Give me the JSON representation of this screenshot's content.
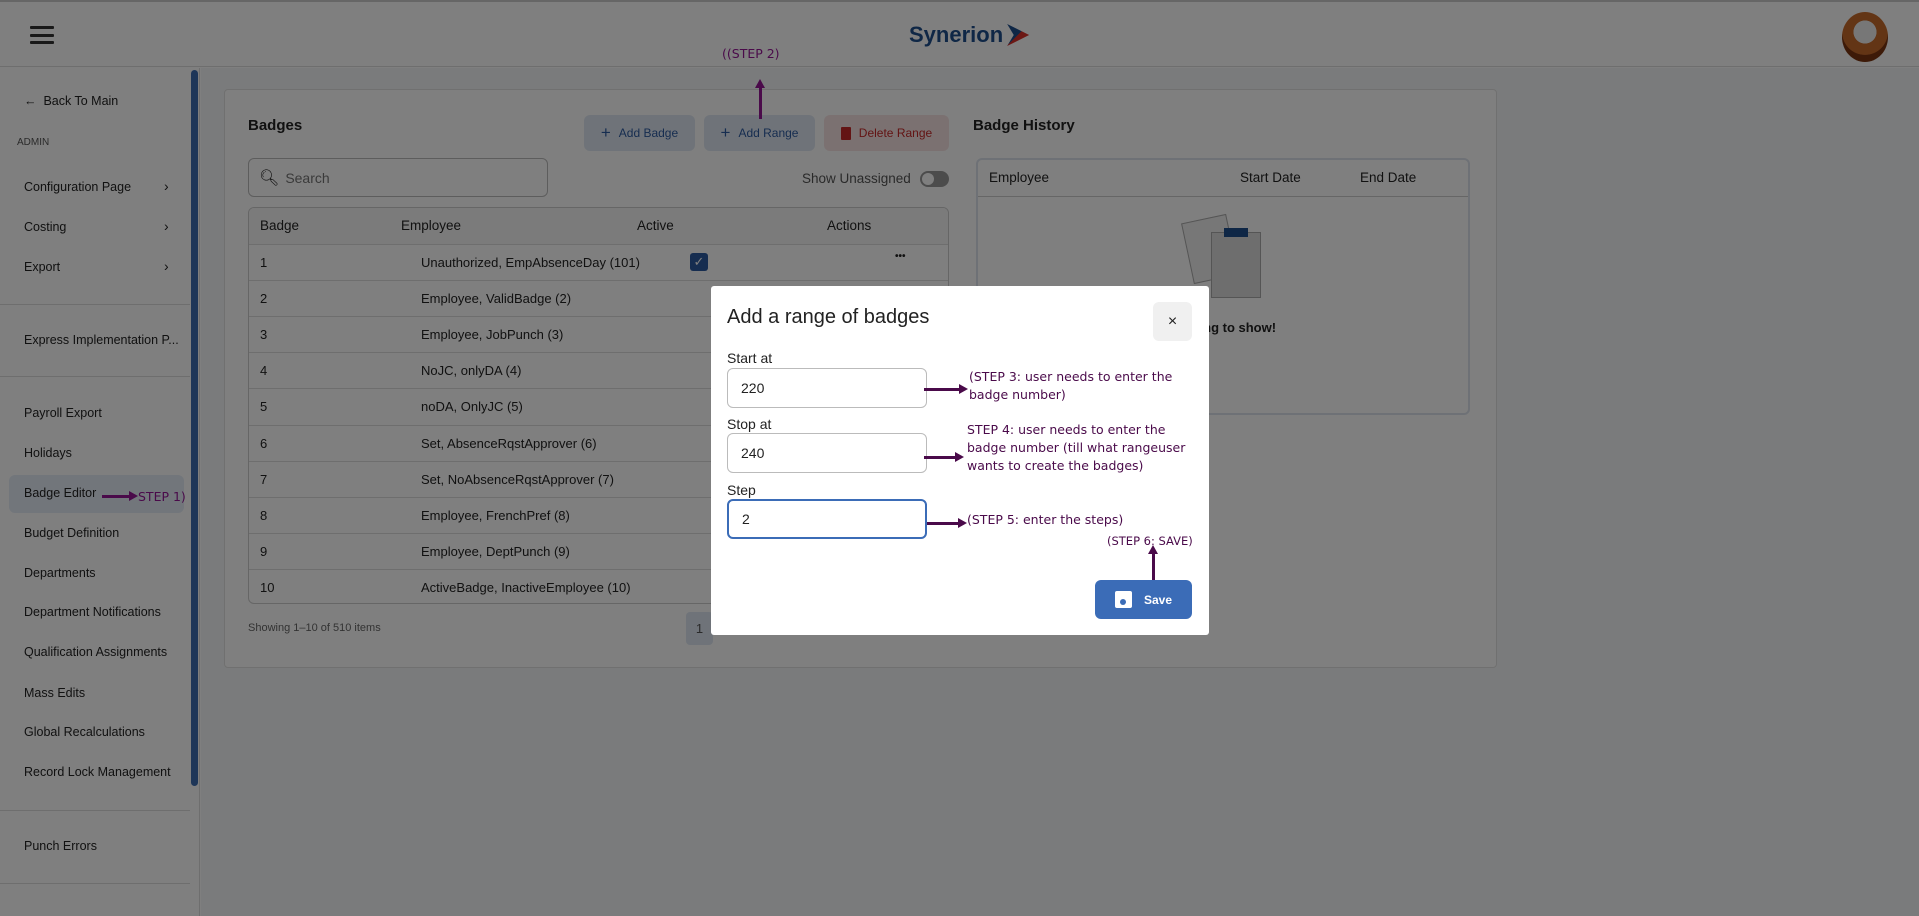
{
  "header": {
    "brand": "Synerion",
    "menu_icon": "hamburger-icon",
    "avatar": "user-avatar"
  },
  "sidebar": {
    "back": "Back To Main",
    "section": "ADMIN",
    "items": [
      {
        "label": "Configuration Page"
      },
      {
        "label": "Costing"
      },
      {
        "label": "Export"
      },
      {
        "label": "Express Implementation P..."
      },
      {
        "label": "Payroll Export"
      },
      {
        "label": "Holidays"
      },
      {
        "label": "Badge Editor"
      },
      {
        "label": "Budget Definition"
      },
      {
        "label": "Departments"
      },
      {
        "label": "Department Notifications"
      },
      {
        "label": "Qualification Assignments"
      },
      {
        "label": "Mass Edits"
      },
      {
        "label": "Global Recalculations"
      },
      {
        "label": "Record Lock Management"
      },
      {
        "label": "Punch Errors"
      }
    ],
    "selected": "Badge Editor"
  },
  "badges": {
    "title": "Badges",
    "add_badge": "Add Badge",
    "add_range": "Add Range",
    "delete_range": "Delete Range",
    "search_placeholder": "Search",
    "show_unassigned": "Show Unassigned",
    "show_unassigned_on": false,
    "columns": [
      "Badge",
      "Employee",
      "Active",
      "Actions"
    ],
    "rows": [
      {
        "badge": "1",
        "employee": "Unauthorized, EmpAbsenceDay (101)",
        "active": true
      },
      {
        "badge": "2",
        "employee": "Employee, ValidBadge (2)"
      },
      {
        "badge": "3",
        "employee": "Employee, JobPunch (3)"
      },
      {
        "badge": "4",
        "employee": "NoJC, onlyDA (4)"
      },
      {
        "badge": "5",
        "employee": "noDA, OnlyJC (5)"
      },
      {
        "badge": "6",
        "employee": "Set, AbsenceRqstApprover (6)"
      },
      {
        "badge": "7",
        "employee": "Set, NoAbsenceRqstApprover (7)"
      },
      {
        "badge": "8",
        "employee": "Employee, FrenchPref (8)"
      },
      {
        "badge": "9",
        "employee": "Employee, DeptPunch (9)"
      },
      {
        "badge": "10",
        "employee": "ActiveBadge, InactiveEmployee (10)"
      }
    ],
    "footer": "Showing 1–10 of 510 items",
    "page": "1"
  },
  "history": {
    "title": "Badge History",
    "columns": [
      "Employee",
      "Start Date",
      "End Date"
    ],
    "empty": "Nothing to show!"
  },
  "modal": {
    "title": "Add a range of badges",
    "close": "×",
    "start_label": "Start at",
    "start_value": "220",
    "stop_label": "Stop at",
    "stop_value": "240",
    "step_label": "Step",
    "step_value": "2",
    "save": "Save"
  },
  "annotations": {
    "step1": "STEP 1)",
    "step2": "((STEP 2)",
    "step3_l1": "(STEP 3: user needs to enter the",
    "step3_l2": "badge number)",
    "step4_l1": "STEP 4: user needs to enter the",
    "step4_l2": "badge number (till what rangeuser",
    "step4_l3": " wants to create the badges)",
    "step5": "(STEP 5: enter the steps)",
    "step6": "(STEP 6: SAVE)"
  },
  "colors": {
    "primary": "#3b6cb7",
    "danger": "#c62828",
    "annotation": "#4a0a4a"
  }
}
